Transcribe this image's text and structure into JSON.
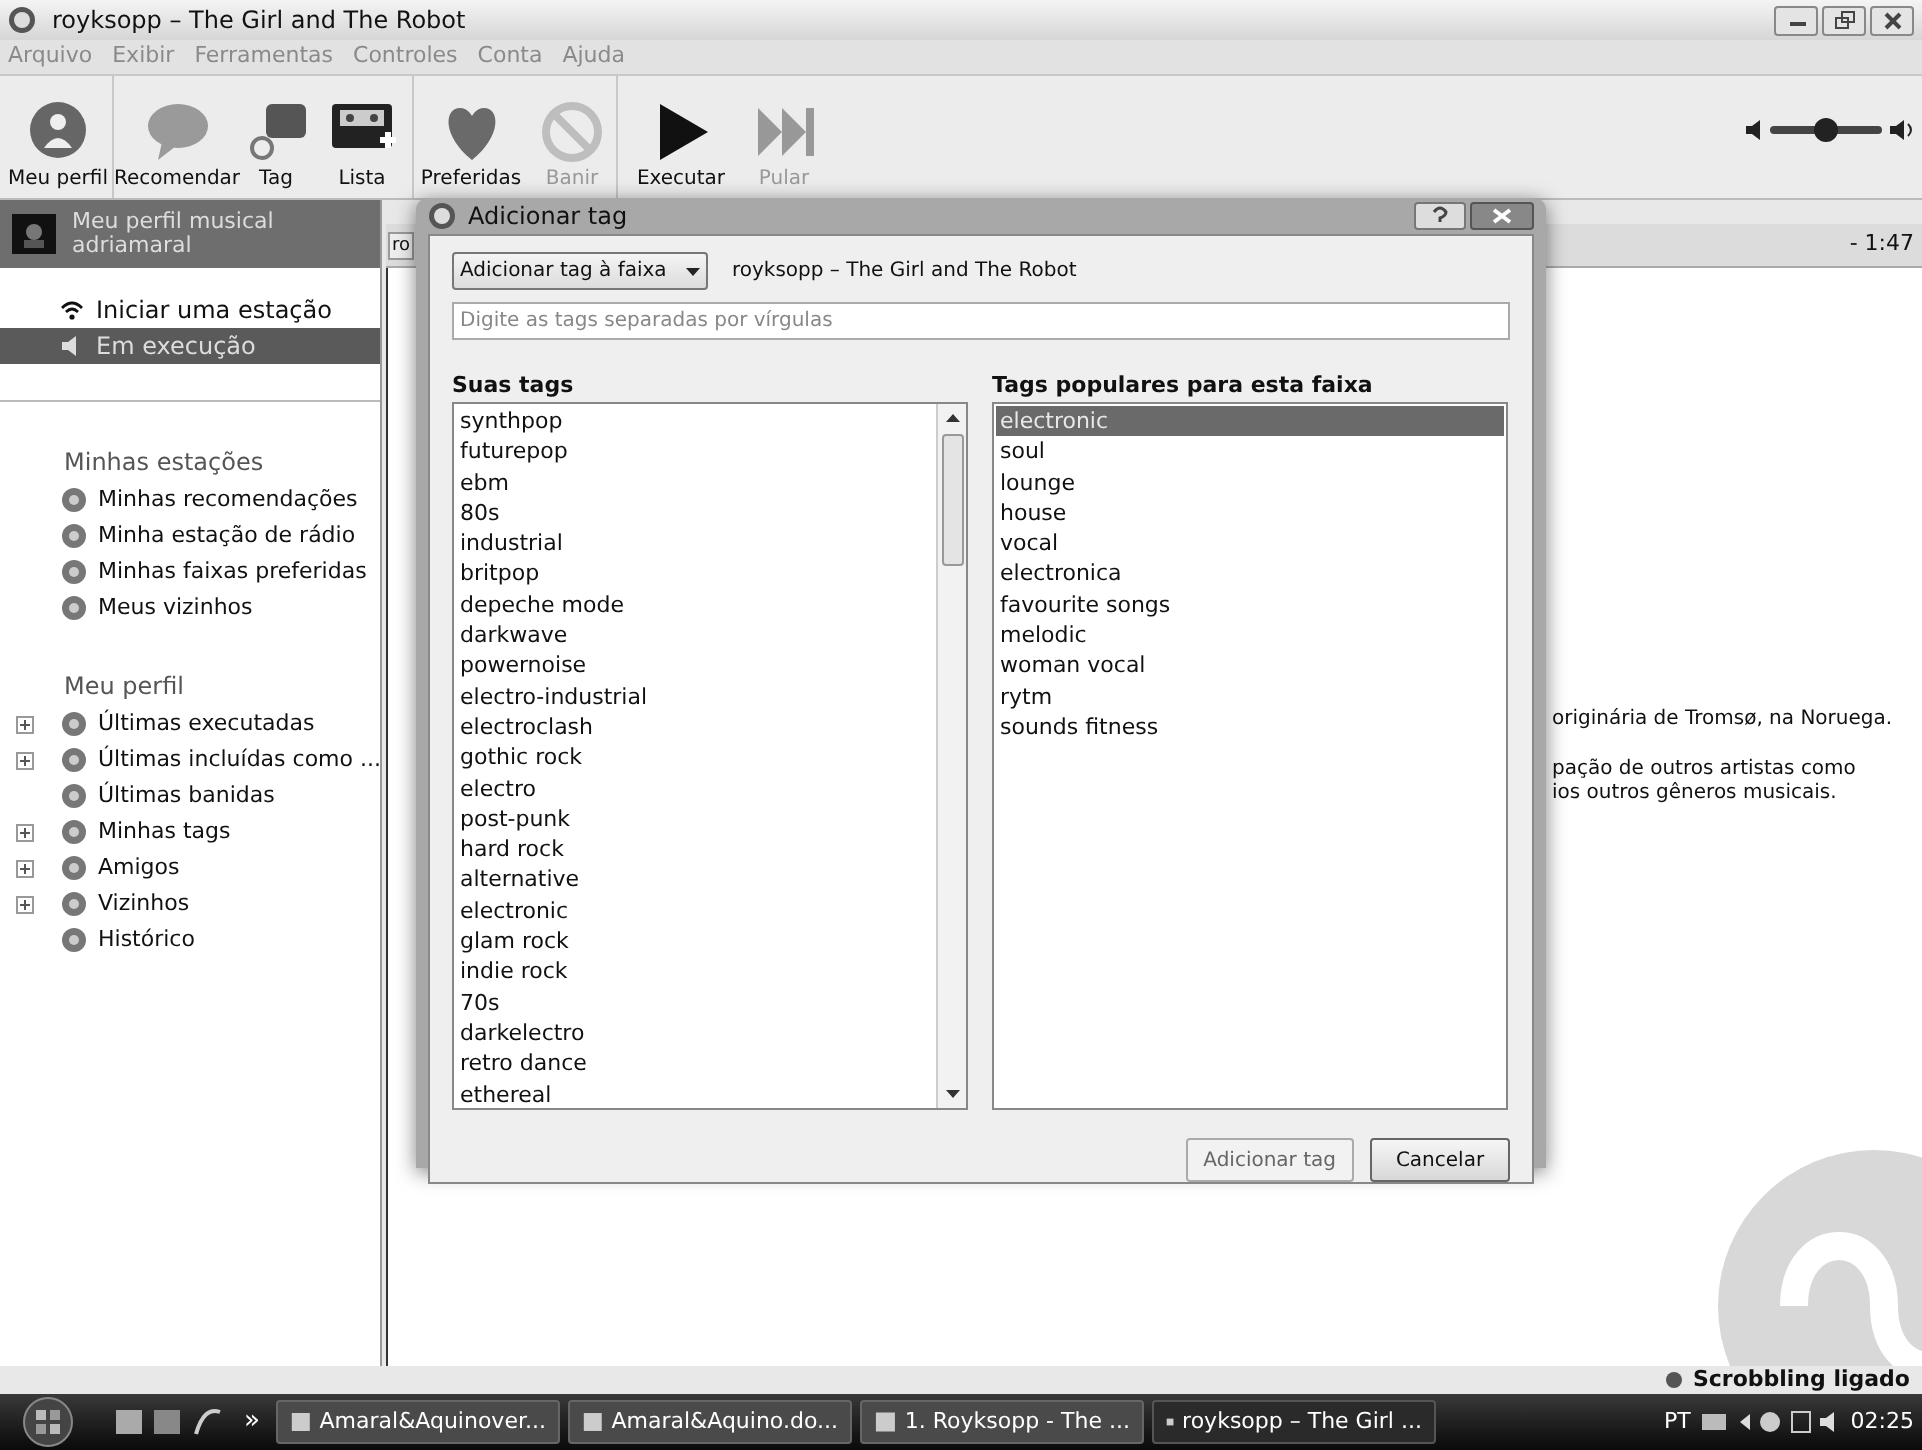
{
  "window": {
    "title": "royksopp – The Girl and The Robot"
  },
  "menu": [
    "Arquivo",
    "Exibir",
    "Ferramentas",
    "Controles",
    "Conta",
    "Ajuda"
  ],
  "toolbar": [
    {
      "kind": "profile",
      "label": "Meu perfil",
      "disabled": false
    },
    {
      "kind": "bubble",
      "label": "Recomendar",
      "disabled": false
    },
    {
      "kind": "tag",
      "label": "Tag",
      "disabled": false
    },
    {
      "kind": "cassette",
      "label": "Lista",
      "disabled": false
    },
    {
      "kind": "heart",
      "label": "Preferidas",
      "disabled": false
    },
    {
      "kind": "ban",
      "label": "Banir",
      "disabled": true
    },
    {
      "kind": "play",
      "label": "Executar",
      "disabled": false
    },
    {
      "kind": "skip",
      "label": "Pular",
      "disabled": true
    }
  ],
  "volume": {
    "level": 0.5
  },
  "sidebar": {
    "profile_title": "Meu perfil musical",
    "username": "adriamaral",
    "nav": [
      {
        "label": "Iniciar uma estação",
        "selected": false
      },
      {
        "label": "Em execução",
        "selected": true
      }
    ],
    "sections": [
      {
        "title": "Minhas estações",
        "items": [
          {
            "label": "Minhas recomendações",
            "expandable": false
          },
          {
            "label": "Minha estação de rádio",
            "expandable": false
          },
          {
            "label": "Minhas faixas preferidas",
            "expandable": false
          },
          {
            "label": "Meus vizinhos",
            "expandable": false
          }
        ]
      },
      {
        "title": "Meu perfil",
        "items": [
          {
            "label": "Últimas executadas",
            "expandable": true
          },
          {
            "label": "Últimas incluídas como ...",
            "expandable": true
          },
          {
            "label": "Últimas banidas",
            "expandable": false
          },
          {
            "label": "Minhas tags",
            "expandable": true
          },
          {
            "label": "Amigos",
            "expandable": true
          },
          {
            "label": "Vizinhos",
            "expandable": true
          },
          {
            "label": "Histórico",
            "expandable": false
          }
        ]
      }
    ]
  },
  "content": {
    "tab": "ro",
    "remaining": "- 1:47",
    "text_lines": [
      "originária de Tromsø, na Noruega.",
      "pação de outros artistas como",
      "ios outros gêneros musicais."
    ]
  },
  "dialog": {
    "title": "Adicionar tag",
    "dropdown": "Adicionar tag à faixa",
    "track": "royksopp – The Girl and The Robot",
    "placeholder": "Digite as tags separadas por vírgulas",
    "your_tags_heading": "Suas tags",
    "your_tags": [
      "synthpop",
      "futurepop",
      "ebm",
      "80s",
      "industrial",
      "britpop",
      "depeche mode",
      "darkwave",
      "powernoise",
      "electro-industrial",
      "electroclash",
      "gothic rock",
      "electro",
      "post-punk",
      "hard rock",
      "alternative",
      "electronic",
      "glam rock",
      "indie rock",
      "70s",
      "darkelectro",
      "retro dance",
      "ethereal"
    ],
    "popular_heading": "Tags populares para esta faixa",
    "popular_tags": [
      {
        "label": "electronic",
        "selected": true
      },
      {
        "label": "soul",
        "selected": false
      },
      {
        "label": "lounge",
        "selected": false
      },
      {
        "label": "house",
        "selected": false
      },
      {
        "label": "vocal",
        "selected": false
      },
      {
        "label": "electronica",
        "selected": false
      },
      {
        "label": "favourite songs",
        "selected": false
      },
      {
        "label": "melodic",
        "selected": false
      },
      {
        "label": "woman vocal",
        "selected": false
      },
      {
        "label": "rytm",
        "selected": false
      },
      {
        "label": "sounds fitness",
        "selected": false
      }
    ],
    "buttons": [
      {
        "label": "Adicionar tag",
        "disabled": true
      },
      {
        "label": "Cancelar",
        "disabled": false
      }
    ]
  },
  "status_bar": {
    "text": "Scrobbling ligado"
  },
  "taskbar": {
    "tasks": [
      {
        "label": "Amaral&Aquinover...",
        "selected": false
      },
      {
        "label": "Amaral&Aquino.do...",
        "selected": false
      },
      {
        "label": "1. Royksopp - The ...",
        "selected": false
      },
      {
        "label": "royksopp – The Girl ...",
        "selected": true
      }
    ],
    "chevron": "»",
    "language": "PT",
    "clock": "02:25"
  }
}
